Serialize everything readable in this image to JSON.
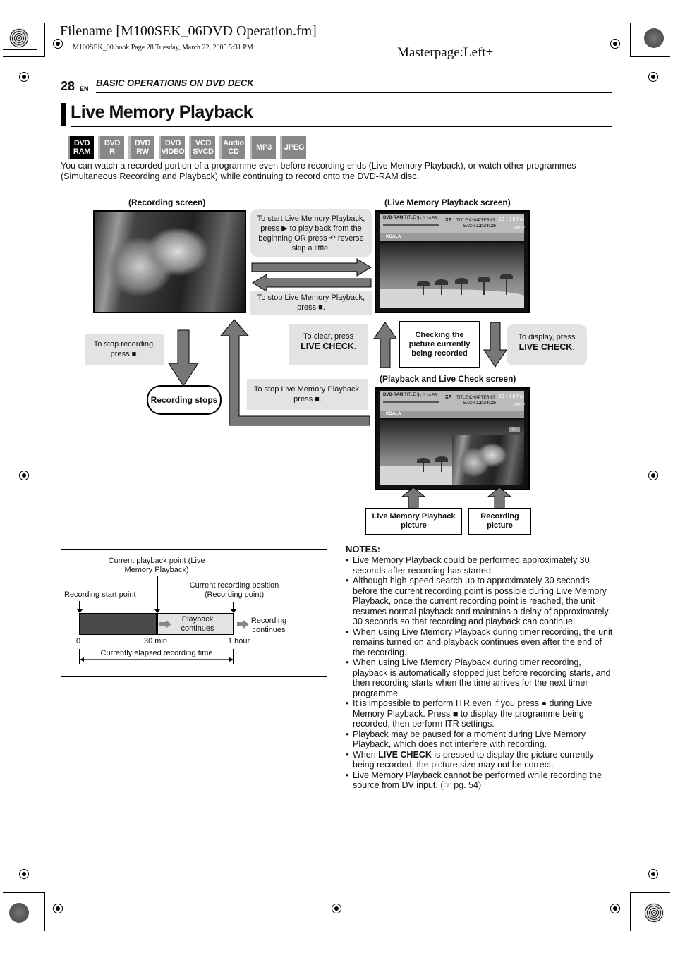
{
  "print_header": {
    "filename": "Filename [M100SEK_06DVD Operation.fm]",
    "book_line": "M100SEK_00.book  Page 28  Tuesday, March 22, 2005  5:31 PM",
    "masterpage": "Masterpage:Left+"
  },
  "page": {
    "number": "28",
    "lang": "EN",
    "section": "BASIC OPERATIONS ON DVD DECK",
    "title": "Live Memory Playback"
  },
  "media_badges": [
    {
      "line1": "DVD",
      "line2": "RAM",
      "active": true
    },
    {
      "line1": "DVD",
      "line2": "R",
      "active": false
    },
    {
      "line1": "DVD",
      "line2": "RW",
      "active": false
    },
    {
      "line1": "DVD",
      "line2": "VIDEO",
      "active": false
    },
    {
      "line1": "VCD",
      "line2": "SVCD",
      "active": false
    },
    {
      "line1": "Audio",
      "line2": "CD",
      "active": false
    },
    {
      "line1": "MP3",
      "line2": "",
      "active": false
    },
    {
      "line1": "JPEG",
      "line2": "",
      "active": false
    }
  ],
  "intro": "You can watch a recorded portion of a programme even before recording ends (Live Memory Playback), or watch other programmes (Simultaneous Recording and Playback) while continuing to record onto the DVD-RAM disc.",
  "diagram": {
    "recording_screen_caption": "(Recording screen)",
    "lmp_screen_caption": "(Live Memory Playback screen)",
    "plc_screen_caption": "(Playback and Live Check screen)",
    "start_lmp": "To start Live Memory Playback, press ▶ to play back from the beginning OR press ↶ reverse skip a little.",
    "stop_lmp_1": "To stop Live Memory Playback, press ■.",
    "stop_recording": "To stop recording, press ■.",
    "recording_stops": "Recording stops",
    "stop_lmp_2": "To stop Live Memory Playback, press ■.",
    "clear_prefix": "To clear, press",
    "clear_key": "LIVE CHECK",
    "checking": "Checking the picture currently being recorded",
    "display_prefix": "To display, press",
    "display_key": "LIVE CHECK",
    "lmp_picture_label": "Live Memory Playback picture",
    "recording_picture_label": "Recording picture",
    "osd": {
      "disc": "DVD-RAM",
      "title_left": "TITLE 9",
      "elapsed": "▷ 0:14:55",
      "mode": "XP",
      "title_right": "TITLE 9",
      "chapter": "CHAPTER 67",
      "each": "EACH",
      "time": "12:34:25",
      "clock": "10 : 0 0 PM",
      "pr": "PR12",
      "program_name": "KOALA"
    }
  },
  "timeline": {
    "playback_point_label": "Current playback point (Live Memory Playback)",
    "recording_position_label": "Current recording position (Recording point)",
    "start_point_label": "Recording start point",
    "playback_continues": "Playback continues",
    "recording_continues": "Recording continues",
    "tick_0": "0",
    "tick_30": "30 min",
    "tick_1h": "1 hour",
    "elapsed_label": "Currently elapsed recording time"
  },
  "notes": {
    "heading": "NOTES:",
    "items": [
      "Live Memory Playback could be performed approximately 30 seconds after recording has started.",
      "Although high-speed search up to approximately 30 seconds before the current recording point is possible during Live Memory Playback, once the current recording point is reached, the unit resumes normal playback and maintains a delay of approximately 30 seconds so that recording and playback can continue.",
      "When using Live Memory Playback during timer recording, the unit remains turned on and playback continues even after the end of the recording.",
      "When using Live Memory Playback during timer recording, playback is automatically stopped just before recording starts, and then recording starts when the time arrives for the next timer programme.",
      "It is impossible to perform ITR even if you press ● during Live Memory Playback. Press ■ to display the programme being recorded, then perform ITR settings.",
      "Playback may be paused for a moment during Live Memory Playback, which does not interfere with recording.",
      "When LIVE CHECK is pressed to display the picture currently being recorded, the picture size may not be correct.",
      "Live Memory Playback cannot be performed while recording the source from DV input. (☞ pg. 54)"
    ]
  }
}
